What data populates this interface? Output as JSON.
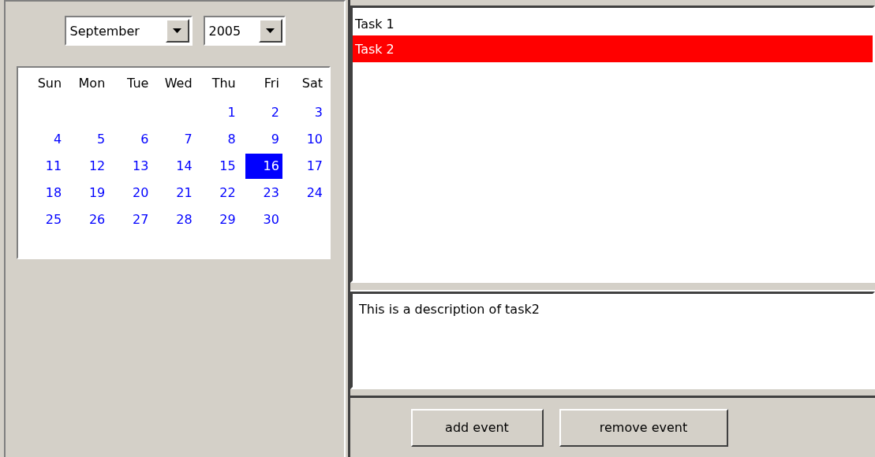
{
  "month_select": {
    "value": "September"
  },
  "year_select": {
    "value": "2005"
  },
  "calendar": {
    "weekdays": [
      "Sun",
      "Mon",
      "Tue",
      "Wed",
      "Thu",
      "Fri",
      "Sat"
    ],
    "weeks": [
      [
        {
          "day": "1",
          "selected": false
        },
        {
          "day": "2",
          "selected": false
        },
        {
          "day": "3",
          "selected": false
        }
      ],
      [
        {
          "day": "4",
          "selected": false
        },
        {
          "day": "5",
          "selected": false
        },
        {
          "day": "6",
          "selected": false
        },
        {
          "day": "7",
          "selected": false
        },
        {
          "day": "8",
          "selected": false
        },
        {
          "day": "9",
          "selected": false
        },
        {
          "day": "10",
          "selected": false
        }
      ],
      [
        {
          "day": "11",
          "selected": false
        },
        {
          "day": "12",
          "selected": false
        },
        {
          "day": "13",
          "selected": false
        },
        {
          "day": "14",
          "selected": false
        },
        {
          "day": "15",
          "selected": false
        },
        {
          "day": "16",
          "selected": true
        },
        {
          "day": "17",
          "selected": false
        }
      ],
      [
        {
          "day": "18",
          "selected": false
        },
        {
          "day": "19",
          "selected": false
        },
        {
          "day": "20",
          "selected": false
        },
        {
          "day": "21",
          "selected": false
        },
        {
          "day": "22",
          "selected": false
        },
        {
          "day": "23",
          "selected": false
        },
        {
          "day": "24",
          "selected": false
        }
      ],
      [
        {
          "day": "25",
          "selected": false
        },
        {
          "day": "26",
          "selected": false
        },
        {
          "day": "27",
          "selected": false
        },
        {
          "day": "28",
          "selected": false
        },
        {
          "day": "29",
          "selected": false
        },
        {
          "day": "30",
          "selected": false
        }
      ]
    ]
  },
  "tasks": [
    {
      "label": "Task 1",
      "selected": false
    },
    {
      "label": "Task 2",
      "selected": true
    }
  ],
  "description": {
    "value": "This is a description of task2"
  },
  "buttons": [
    {
      "label": "add event"
    },
    {
      "label": "remove event"
    }
  ]
}
